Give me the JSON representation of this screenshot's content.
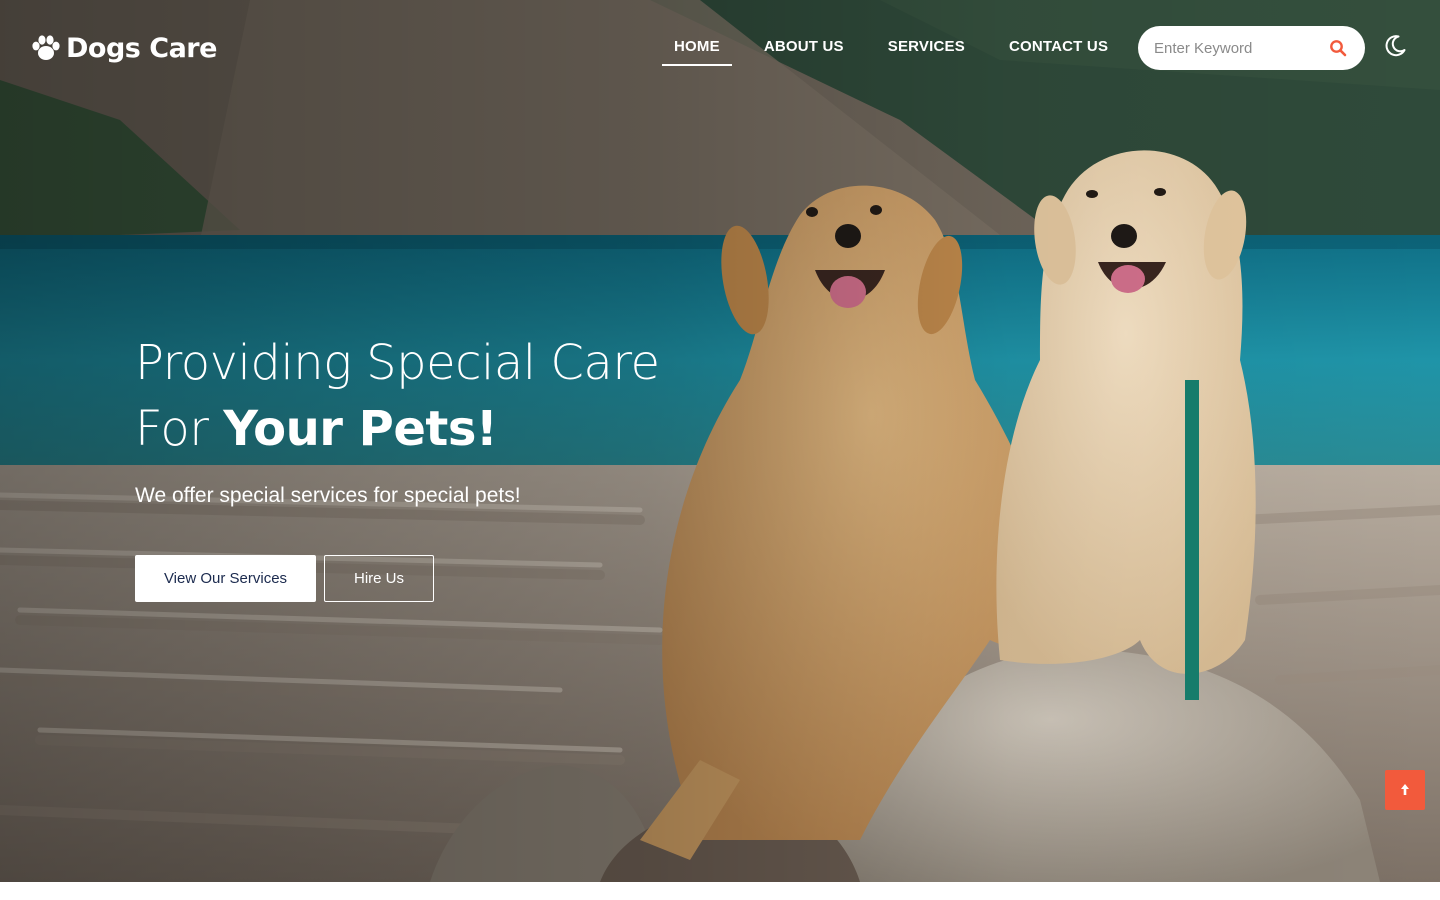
{
  "brand": {
    "name": "Dogs Care",
    "icon": "paw-icon"
  },
  "nav": {
    "items": [
      {
        "label": "HOME",
        "active": true
      },
      {
        "label": "ABOUT US",
        "active": false
      },
      {
        "label": "SERVICES",
        "active": false
      },
      {
        "label": "CONTACT US",
        "active": false
      }
    ]
  },
  "search": {
    "placeholder": "Enter Keyword",
    "value": "",
    "icon": "search-icon"
  },
  "theme_toggle": {
    "icon": "moon-icon"
  },
  "hero": {
    "headline_line1": "Providing Special Care",
    "headline_line2_prefix": "For ",
    "headline_line2_bold": "Your Pets!",
    "subtitle": "We offer special services for special pets!",
    "primary_button": "View Our Services",
    "secondary_button": "Hire Us",
    "image_alt": "two golden retrievers sitting on rocks by a mountain lake"
  },
  "scroll_top": {
    "icon": "arrow-up-icon"
  },
  "colors": {
    "accent": "#f25a3c",
    "button_text": "#1b2a4e",
    "lake": "#1f8ea3",
    "mountain": "#6c6358"
  }
}
